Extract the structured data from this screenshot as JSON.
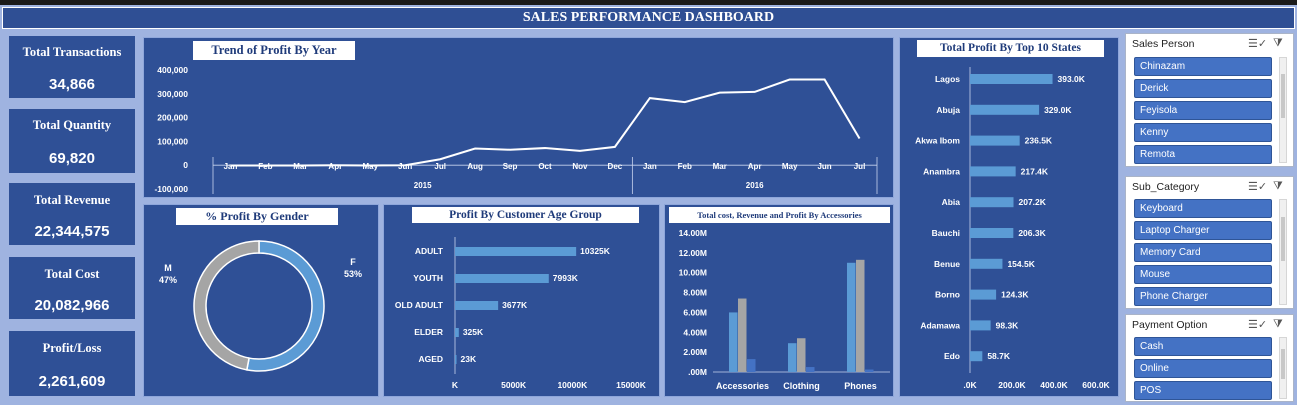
{
  "header": {
    "title": "SALES PERFORMANCE DASHBOARD"
  },
  "kpis": [
    {
      "label": "Total Transactions",
      "value": "34,866"
    },
    {
      "label": "Total Quantity",
      "value": "69,820"
    },
    {
      "label": "Total Revenue",
      "value": "22,344,575"
    },
    {
      "label": "Total Cost",
      "value": "20,082,966"
    },
    {
      "label": "Profit/Loss",
      "value": "2,261,609"
    }
  ],
  "colors": {
    "panel": "#2f5096",
    "background": "#9fb3e0",
    "bar": "#5b9bd5",
    "gray": "#a5a5a5",
    "dark_bar": "#4472c4"
  },
  "chart_data": [
    {
      "id": "trend",
      "type": "line",
      "title": "Trend of Profit By Year",
      "x": [
        "Jan",
        "Feb",
        "Mar",
        "Apr",
        "May",
        "Jun",
        "Jul",
        "Aug",
        "Sep",
        "Oct",
        "Nov",
        "Dec",
        "Jan",
        "Feb",
        "Mar",
        "Apr",
        "May",
        "Jun",
        "Jul"
      ],
      "groups": [
        {
          "label": "2015",
          "count": 12
        },
        {
          "label": "2016",
          "count": 7
        }
      ],
      "values": [
        -1000,
        -1500,
        -1000,
        0,
        -1000,
        0,
        25000,
        70000,
        65000,
        72000,
        60000,
        77000,
        282000,
        265000,
        305000,
        308000,
        360000,
        360000,
        112000
      ],
      "ylim": [
        -100000,
        400000
      ],
      "yticks": [
        400000,
        300000,
        200000,
        100000,
        0,
        -100000
      ],
      "ytick_labels": [
        "400,000",
        "300,000",
        "200,000",
        "100,000",
        "0",
        "-100,000"
      ]
    },
    {
      "id": "gender",
      "type": "pie",
      "title": "% Profit By Gender",
      "slices": [
        {
          "label": "F",
          "pct": "53%",
          "value": 53,
          "color": "#5b9bd5"
        },
        {
          "label": "M",
          "pct": "47%",
          "value": 47,
          "color": "#a5a5a5"
        }
      ]
    },
    {
      "id": "age",
      "type": "bar",
      "title": "Profit By Customer Age Group",
      "categories": [
        "ADULT",
        "YOUTH",
        "OLD ADULT",
        "ELDER",
        "AGED"
      ],
      "values": [
        10325,
        7993,
        3677,
        325,
        23
      ],
      "value_labels": [
        "10325K",
        "7993K",
        "3677K",
        "325K",
        "23K"
      ],
      "xlim": [
        0,
        15000
      ],
      "xticks": [
        0,
        5000,
        10000,
        15000
      ],
      "xtick_labels": [
        "K",
        "5000K",
        "10000K",
        "15000K"
      ]
    },
    {
      "id": "accessories",
      "type": "bar",
      "title": "Total cost, Revenue and Profit By Accessories",
      "categories": [
        "Accessories",
        "Clothing",
        "Phones"
      ],
      "series": [
        {
          "values": [
            6.0,
            2.9,
            11.0
          ],
          "color": "#5b9bd5"
        },
        {
          "values": [
            7.4,
            3.4,
            11.3
          ],
          "color": "#a5a5a5"
        },
        {
          "values": [
            1.3,
            0.5,
            0.25
          ],
          "color": "#4472c4"
        }
      ],
      "ylim": [
        0,
        14
      ],
      "yticks": [
        14,
        12,
        10,
        8,
        6,
        4,
        2,
        0
      ],
      "ytick_labels": [
        "14.00M",
        "12.00M",
        "10.00M",
        "8.00M",
        "6.00M",
        "4.00M",
        "2.00M",
        ".00M"
      ]
    },
    {
      "id": "states",
      "type": "bar",
      "title": "Total Profit By Top 10 States",
      "categories": [
        "Lagos",
        "Abuja",
        "Akwa Ibom",
        "Anambra",
        "Abia",
        "Bauchi",
        "Benue",
        "Borno",
        "Adamawa",
        "Edo"
      ],
      "values": [
        393.0,
        329.0,
        236.5,
        217.4,
        207.2,
        206.3,
        154.5,
        124.3,
        98.3,
        58.7
      ],
      "value_labels": [
        "393.0K",
        "329.0K",
        "236.5K",
        "217.4K",
        "207.2K",
        "206.3K",
        "154.5K",
        "124.3K",
        "98.3K",
        "58.7K"
      ],
      "xlim": [
        0,
        600
      ],
      "xticks": [
        0,
        200,
        400,
        600
      ],
      "xtick_labels": [
        ".0K",
        "200.0K",
        "400.0K",
        "600.0K"
      ]
    }
  ],
  "slicers": [
    {
      "title": "Sales Person",
      "items": [
        "Chinazam",
        "Derick",
        "Feyisola",
        "Kenny",
        "Remota"
      ]
    },
    {
      "title": "Sub_Category",
      "items": [
        "Keyboard",
        "Laptop Charger",
        "Memory Card",
        "Mouse",
        "Phone Charger"
      ]
    },
    {
      "title": "Payment Option",
      "items": [
        "Cash",
        "Online",
        "POS"
      ]
    }
  ],
  "slicer_icons": {
    "multi_select": "multi-select-icon",
    "clear_filter": "clear-filter-icon"
  }
}
